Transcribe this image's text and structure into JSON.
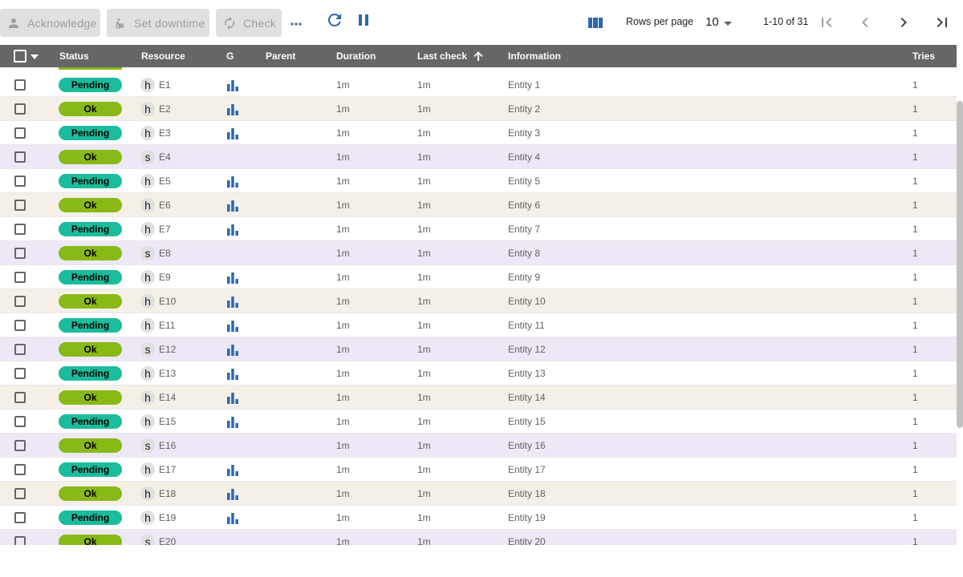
{
  "toolbar": {
    "acknowledge_label": "Acknowledge",
    "downtime_label": "Set downtime",
    "check_label": "Check",
    "rows_per_page_label": "Rows per page",
    "rows_per_page_value": "10",
    "page_range": "1-10 of 31"
  },
  "table": {
    "columns": [
      "Status",
      "Resource",
      "G",
      "Parent",
      "Duration",
      "Last check",
      "Information",
      "Tries"
    ],
    "rows": [
      {
        "status": "Pending",
        "type": "h",
        "name": "E1",
        "graph": true,
        "duration": "1m",
        "last_check": "1m",
        "information": "Entity 1",
        "tries": "1"
      },
      {
        "status": "Ok",
        "type": "h",
        "name": "E2",
        "graph": true,
        "duration": "1m",
        "last_check": "1m",
        "information": "Entity 2",
        "tries": "1"
      },
      {
        "status": "Pending",
        "type": "h",
        "name": "E3",
        "graph": true,
        "duration": "1m",
        "last_check": "1m",
        "information": "Entity 3",
        "tries": "1"
      },
      {
        "status": "Ok",
        "type": "s",
        "name": "E4",
        "graph": false,
        "duration": "1m",
        "last_check": "1m",
        "information": "Entity 4",
        "tries": "1"
      },
      {
        "status": "Pending",
        "type": "h",
        "name": "E5",
        "graph": true,
        "duration": "1m",
        "last_check": "1m",
        "information": "Entity 5",
        "tries": "1"
      },
      {
        "status": "Ok",
        "type": "h",
        "name": "E6",
        "graph": true,
        "duration": "1m",
        "last_check": "1m",
        "information": "Entity 6",
        "tries": "1"
      },
      {
        "status": "Pending",
        "type": "h",
        "name": "E7",
        "graph": true,
        "duration": "1m",
        "last_check": "1m",
        "information": "Entity 7",
        "tries": "1"
      },
      {
        "status": "Ok",
        "type": "s",
        "name": "E8",
        "graph": false,
        "duration": "1m",
        "last_check": "1m",
        "information": "Entity 8",
        "tries": "1"
      },
      {
        "status": "Pending",
        "type": "h",
        "name": "E9",
        "graph": true,
        "duration": "1m",
        "last_check": "1m",
        "information": "Entity 9",
        "tries": "1"
      },
      {
        "status": "Ok",
        "type": "h",
        "name": "E10",
        "graph": true,
        "duration": "1m",
        "last_check": "1m",
        "information": "Entity 10",
        "tries": "1"
      },
      {
        "status": "Pending",
        "type": "h",
        "name": "E11",
        "graph": true,
        "duration": "1m",
        "last_check": "1m",
        "information": "Entity 11",
        "tries": "1"
      },
      {
        "status": "Ok",
        "type": "s",
        "name": "E12",
        "graph": true,
        "duration": "1m",
        "last_check": "1m",
        "information": "Entity 12",
        "tries": "1"
      },
      {
        "status": "Pending",
        "type": "h",
        "name": "E13",
        "graph": true,
        "duration": "1m",
        "last_check": "1m",
        "information": "Entity 13",
        "tries": "1"
      },
      {
        "status": "Ok",
        "type": "h",
        "name": "E14",
        "graph": true,
        "duration": "1m",
        "last_check": "1m",
        "information": "Entity 14",
        "tries": "1"
      },
      {
        "status": "Pending",
        "type": "h",
        "name": "E15",
        "graph": true,
        "duration": "1m",
        "last_check": "1m",
        "information": "Entity 15",
        "tries": "1"
      },
      {
        "status": "Ok",
        "type": "s",
        "name": "E16",
        "graph": false,
        "duration": "1m",
        "last_check": "1m",
        "information": "Entity 16",
        "tries": "1"
      },
      {
        "status": "Pending",
        "type": "h",
        "name": "E17",
        "graph": true,
        "duration": "1m",
        "last_check": "1m",
        "information": "Entity 17",
        "tries": "1"
      },
      {
        "status": "Ok",
        "type": "h",
        "name": "E18",
        "graph": true,
        "duration": "1m",
        "last_check": "1m",
        "information": "Entity 18",
        "tries": "1"
      },
      {
        "status": "Pending",
        "type": "h",
        "name": "E19",
        "graph": true,
        "duration": "1m",
        "last_check": "1m",
        "information": "Entity 19",
        "tries": "1"
      },
      {
        "status": "Ok",
        "type": "s",
        "name": "E20",
        "graph": false,
        "duration": "1m",
        "last_check": "1m",
        "information": "Entity 20",
        "tries": "1"
      }
    ]
  },
  "colors": {
    "pending": "#1abc9c",
    "ok": "#88b917",
    "header_bg": "#666666",
    "accent_icon": "#2e68aa"
  },
  "icons": {
    "acknowledge": "person-icon",
    "downtime": "downtime-icon",
    "check": "refresh-check-icon",
    "more": "more-horiz-icon",
    "refresh": "refresh-icon",
    "pause": "pause-icon",
    "columns": "view-columns-icon",
    "graph": "bar-chart-icon"
  }
}
